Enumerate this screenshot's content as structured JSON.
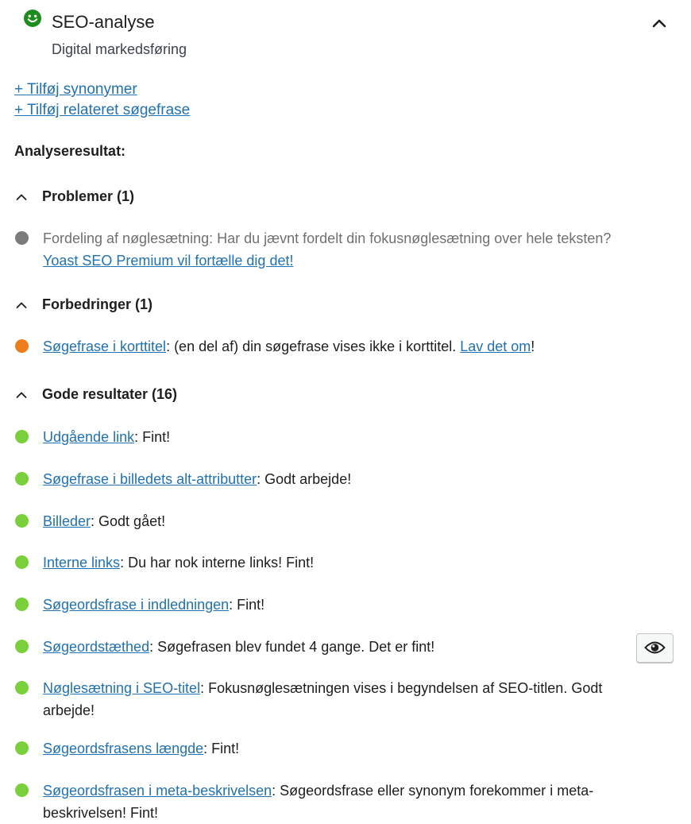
{
  "header": {
    "title": "SEO-analyse",
    "subtitle": "Digital markedsføring",
    "status_color": "#1e8c1e"
  },
  "links": [
    {
      "label": "+ Tilføj synonymer"
    },
    {
      "label": "+ Tilføj relateret søgefrase"
    }
  ],
  "analysis_heading": "Analyseresultat:",
  "sections": {
    "problems": {
      "title": "Problemer (1)",
      "items": [
        {
          "text": "Fordeling af nøglesætning: Har du jævnt fordelt din fokusnøglesætning over hele teksten?",
          "link": "Yoast SEO Premium vil fortælle dig det!",
          "color": "#7b7b7b"
        }
      ]
    },
    "improvements": {
      "title": "Forbedringer (1)",
      "items": [
        {
          "link": "Søgefrase i korttitel",
          "text": ": (en del af) din søgefrase vises ikke i korttitel. ",
          "link2": "Lav det om",
          "tail": "!",
          "color": "#ee7c1b"
        }
      ]
    },
    "good": {
      "title": "Gode resultater (16)",
      "items": [
        {
          "link": "Udgående link",
          "text": ": Fint!",
          "color": "#7ad03a"
        },
        {
          "link": "Søgefrase i billedets alt-attributter",
          "text": ": Godt arbejde!",
          "color": "#7ad03a"
        },
        {
          "link": "Billeder",
          "text": ": Godt gået!",
          "color": "#7ad03a"
        },
        {
          "link": "Interne links",
          "text": ": Du har nok interne links! Fint!",
          "color": "#7ad03a"
        },
        {
          "link": "Søgeordsfrase i indledningen",
          "text": ": Fint!",
          "color": "#7ad03a"
        },
        {
          "link": "Søgeordstæthed",
          "text": ": Søgefrasen blev fundet 4 gange. Det er fint!",
          "color": "#7ad03a"
        },
        {
          "link": "Nøglesætning i SEO-titel",
          "text": ": Fokusnøglesætningen vises i begyndelsen af SEO-titlen. Godt arbejde!",
          "color": "#7ad03a"
        },
        {
          "link": "Søgeordsfrasens længde",
          "text": ": Fint!",
          "color": "#7ad03a"
        },
        {
          "link": "Søgeordsfrasen i meta-beskrivelsen",
          "text": ": Søgeordsfrase eller synonym forekommer i meta-beskrivelsen! Fint!",
          "color": "#7ad03a"
        }
      ]
    }
  },
  "icons": {
    "status": "smiley-face-icon",
    "collapse": "chevron-up-icon",
    "section_toggle": "chevron-up-icon",
    "highlight": "eye-icon"
  }
}
